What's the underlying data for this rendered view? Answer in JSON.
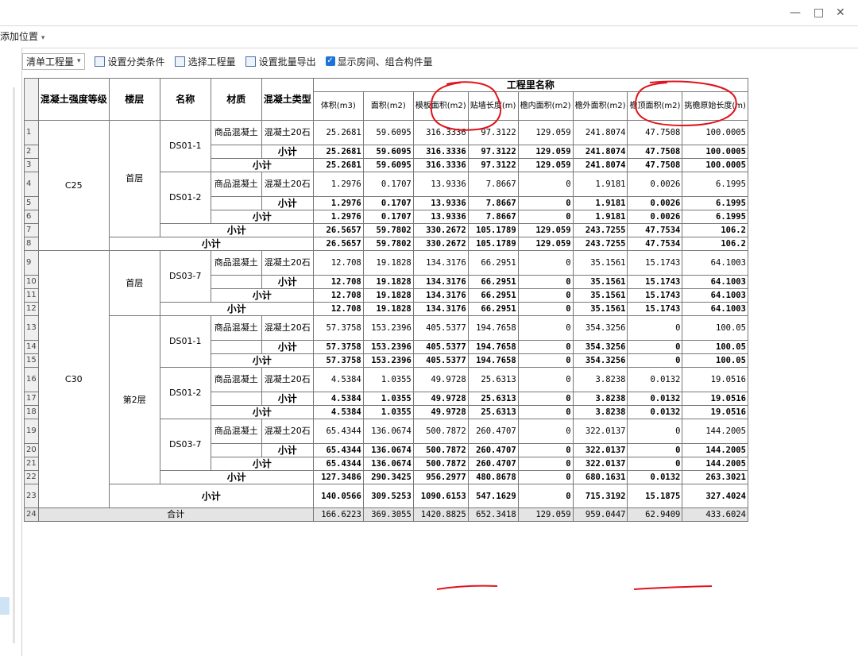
{
  "window": {
    "minimize": "—",
    "restore": "□",
    "close": "✕"
  },
  "menu": {
    "add_position": "添加位置",
    "arrow": "▾"
  },
  "toolbar": {
    "list_quantity": "清单工程量",
    "set_classification": "设置分类条件",
    "select_quantity": "选择工程量",
    "batch_export": "设置批量导出",
    "show_rooms": "显示房间、组合构件量"
  },
  "table": {
    "group_header": "工程里名称",
    "headers": {
      "grade": "混凝土强度等级",
      "floor": "楼层",
      "name": "名称",
      "material": "材质",
      "ctype": "混凝土类型",
      "volume": "体积(m3)",
      "area": "面积(m2)",
      "formwork": "模板面积(m2)",
      "wall_len": "贴墙长度(m)",
      "inner": "檐内面积(m2)",
      "outer": "檐外面积(m2)",
      "top": "檐顶面积(m2)",
      "eave_len": "挑檐原始长度(m)"
    },
    "labels": {
      "c25": "C25",
      "c30": "C30",
      "f1a": "首层",
      "f1b": "首层",
      "f2": "第2层",
      "ds01_1a": "DS01-1",
      "ds01_2a": "DS01-2",
      "ds03_7a": "DS03-7",
      "ds01_1b": "DS01-1",
      "ds01_2b": "DS01-2",
      "ds03_7b": "DS03-7",
      "mat": "商品混凝土",
      "ctype": "混凝土20石",
      "subtotal": "小计",
      "total": "合计"
    },
    "rows": {
      "r1": [
        "25.2681",
        "59.6095",
        "316.3336",
        "97.3122",
        "129.059",
        "241.8074",
        "47.7508",
        "100.0005"
      ],
      "r2": [
        "25.2681",
        "59.6095",
        "316.3336",
        "97.3122",
        "129.059",
        "241.8074",
        "47.7508",
        "100.0005"
      ],
      "r3": [
        "25.2681",
        "59.6095",
        "316.3336",
        "97.3122",
        "129.059",
        "241.8074",
        "47.7508",
        "100.0005"
      ],
      "r4": [
        "1.2976",
        "0.1707",
        "13.9336",
        "7.8667",
        "0",
        "1.9181",
        "0.0026",
        "6.1995"
      ],
      "r5": [
        "1.2976",
        "0.1707",
        "13.9336",
        "7.8667",
        "0",
        "1.9181",
        "0.0026",
        "6.1995"
      ],
      "r6": [
        "1.2976",
        "0.1707",
        "13.9336",
        "7.8667",
        "0",
        "1.9181",
        "0.0026",
        "6.1995"
      ],
      "r7": [
        "26.5657",
        "59.7802",
        "330.2672",
        "105.1789",
        "129.059",
        "243.7255",
        "47.7534",
        "106.2"
      ],
      "r8": [
        "26.5657",
        "59.7802",
        "330.2672",
        "105.1789",
        "129.059",
        "243.7255",
        "47.7534",
        "106.2"
      ],
      "r9": [
        "12.708",
        "19.1828",
        "134.3176",
        "66.2951",
        "0",
        "35.1561",
        "15.1743",
        "64.1003"
      ],
      "r10": [
        "12.708",
        "19.1828",
        "134.3176",
        "66.2951",
        "0",
        "35.1561",
        "15.1743",
        "64.1003"
      ],
      "r11": [
        "12.708",
        "19.1828",
        "134.3176",
        "66.2951",
        "0",
        "35.1561",
        "15.1743",
        "64.1003"
      ],
      "r12": [
        "12.708",
        "19.1828",
        "134.3176",
        "66.2951",
        "0",
        "35.1561",
        "15.1743",
        "64.1003"
      ],
      "r13": [
        "57.3758",
        "153.2396",
        "405.5377",
        "194.7658",
        "0",
        "354.3256",
        "0",
        "100.05"
      ],
      "r14": [
        "57.3758",
        "153.2396",
        "405.5377",
        "194.7658",
        "0",
        "354.3256",
        "0",
        "100.05"
      ],
      "r15": [
        "57.3758",
        "153.2396",
        "405.5377",
        "194.7658",
        "0",
        "354.3256",
        "0",
        "100.05"
      ],
      "r16": [
        "4.5384",
        "1.0355",
        "49.9728",
        "25.6313",
        "0",
        "3.8238",
        "0.0132",
        "19.0516"
      ],
      "r17": [
        "4.5384",
        "1.0355",
        "49.9728",
        "25.6313",
        "0",
        "3.8238",
        "0.0132",
        "19.0516"
      ],
      "r18": [
        "4.5384",
        "1.0355",
        "49.9728",
        "25.6313",
        "0",
        "3.8238",
        "0.0132",
        "19.0516"
      ],
      "r19": [
        "65.4344",
        "136.0674",
        "500.7872",
        "260.4707",
        "0",
        "322.0137",
        "0",
        "144.2005"
      ],
      "r20": [
        "65.4344",
        "136.0674",
        "500.7872",
        "260.4707",
        "0",
        "322.0137",
        "0",
        "144.2005"
      ],
      "r21": [
        "65.4344",
        "136.0674",
        "500.7872",
        "260.4707",
        "0",
        "322.0137",
        "0",
        "144.2005"
      ],
      "r22": [
        "127.3486",
        "290.3425",
        "956.2977",
        "480.8678",
        "0",
        "680.1631",
        "0.0132",
        "263.3021"
      ],
      "r23": [
        "140.0566",
        "309.5253",
        "1090.6153",
        "547.1629",
        "0",
        "715.3192",
        "15.1875",
        "327.4024"
      ],
      "r24": [
        "166.6223",
        "369.3055",
        "1420.8825",
        "652.3418",
        "129.059",
        "959.0447",
        "62.9409",
        "433.6024"
      ]
    }
  },
  "annotation_color": "#e0141e"
}
